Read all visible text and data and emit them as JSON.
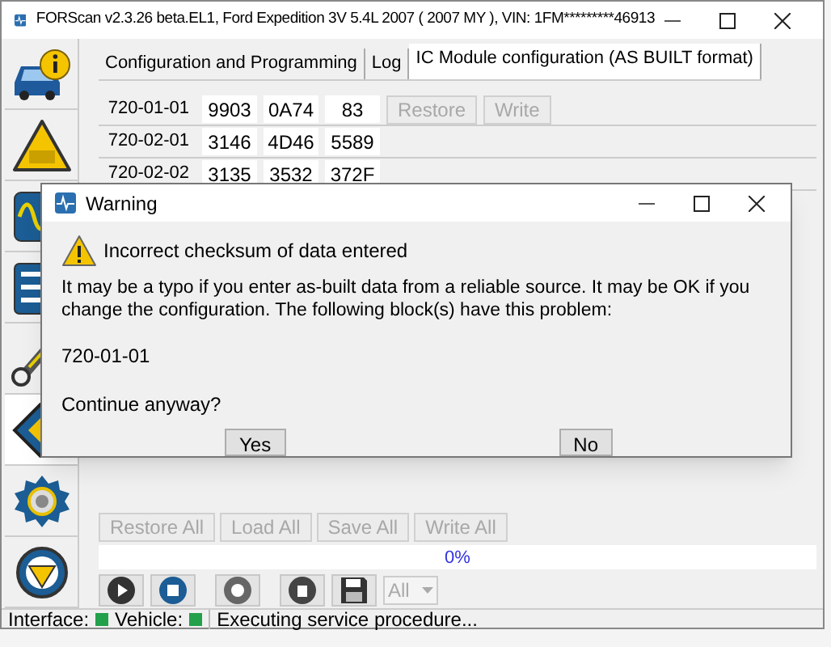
{
  "window": {
    "title": "FORScan v2.3.26 beta.EL1, Ford Expedition 3V 5.4L 2007 ( 2007 MY ), VIN: 1FM*********46913"
  },
  "sidebar": {
    "items": [
      {
        "kind": "info",
        "selected": false
      },
      {
        "kind": "dtc",
        "selected": false
      },
      {
        "kind": "scope",
        "selected": false
      },
      {
        "kind": "checklist",
        "selected": false
      },
      {
        "kind": "wrench",
        "selected": false
      },
      {
        "kind": "chip",
        "selected": true
      },
      {
        "kind": "gear",
        "selected": false
      },
      {
        "kind": "wheel",
        "selected": false
      }
    ]
  },
  "tabs": [
    {
      "label": "Configuration and Programming",
      "selected": false
    },
    {
      "label": "Log",
      "selected": false
    },
    {
      "label": "IC Module configuration (AS BUILT format)",
      "selected": true
    }
  ],
  "rows": [
    {
      "label": "720-01-01",
      "values": [
        "9903",
        "0A74",
        "83"
      ],
      "buttons": [
        {
          "label": "Restore",
          "disabled": true
        },
        {
          "label": "Write",
          "disabled": true
        }
      ]
    },
    {
      "label": "720-02-01",
      "values": [
        "3146",
        "4D46",
        "5589"
      ]
    },
    {
      "label": "720-02-02",
      "values": [
        "3135",
        "3532",
        "372F"
      ]
    }
  ],
  "bulk_buttons": [
    {
      "label": "Restore All",
      "disabled": true
    },
    {
      "label": "Load All",
      "disabled": true
    },
    {
      "label": "Save All",
      "disabled": true
    },
    {
      "label": "Write All",
      "disabled": true
    }
  ],
  "progress": {
    "level": 0,
    "label": "0%"
  },
  "toolbar": {
    "buttons": [
      {
        "kind": "play"
      },
      {
        "kind": "stop"
      },
      {
        "kind": "help"
      },
      {
        "kind": "delete"
      },
      {
        "kind": "save"
      }
    ],
    "filter": {
      "value": "All",
      "disabled": true
    }
  },
  "status_bar": {
    "items": [
      {
        "label": "Interface:",
        "color": "#22a04a"
      },
      {
        "label": "Vehicle:",
        "color": "#22a04a"
      }
    ],
    "message": "Executing service procedure..."
  },
  "dialog": {
    "title": "Warning",
    "heading": "Incorrect checksum of data entered",
    "message": "It may be a typo if you enter as-built data from a reliable source. It may be OK if you change the configuration. The following block(s) have this problem:",
    "block": "720-01-01",
    "question": "Continue anyway?",
    "buttons": [
      "Yes",
      "No"
    ]
  }
}
